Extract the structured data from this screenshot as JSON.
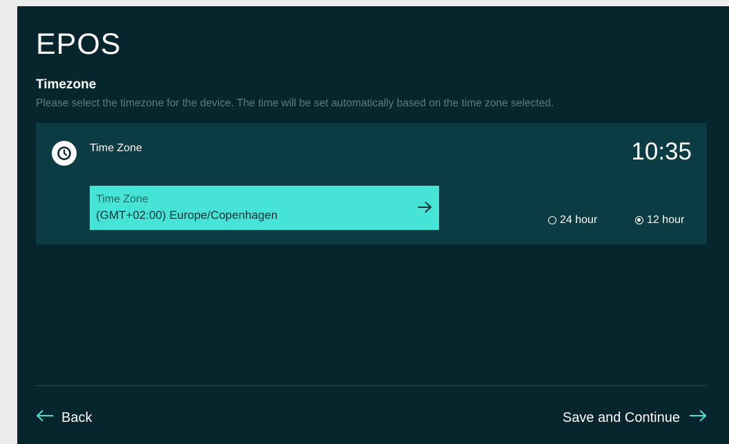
{
  "brand": {
    "logo_text": "EPOS"
  },
  "page": {
    "title": "Timezone",
    "subtitle": "Please select the timezone for the device. The time will be set automatically based on the time zone selected."
  },
  "timezone_card": {
    "icon": "clock-icon",
    "label": "Time Zone",
    "current_time": "10:35",
    "select": {
      "label": "Time Zone",
      "value": "(GMT+02:00) Europe/Copenhagen",
      "icon": "arrow-right-icon"
    },
    "format_options": [
      {
        "label": "24 hour",
        "selected": false
      },
      {
        "label": "12 hour",
        "selected": true
      }
    ]
  },
  "footer": {
    "back_label": "Back",
    "save_label": "Save and Continue"
  },
  "colors": {
    "background": "#07252c",
    "card": "#0b3b43",
    "accent": "#45e4d6",
    "text": "#ffffff",
    "muted_text": "#5e7a80"
  }
}
